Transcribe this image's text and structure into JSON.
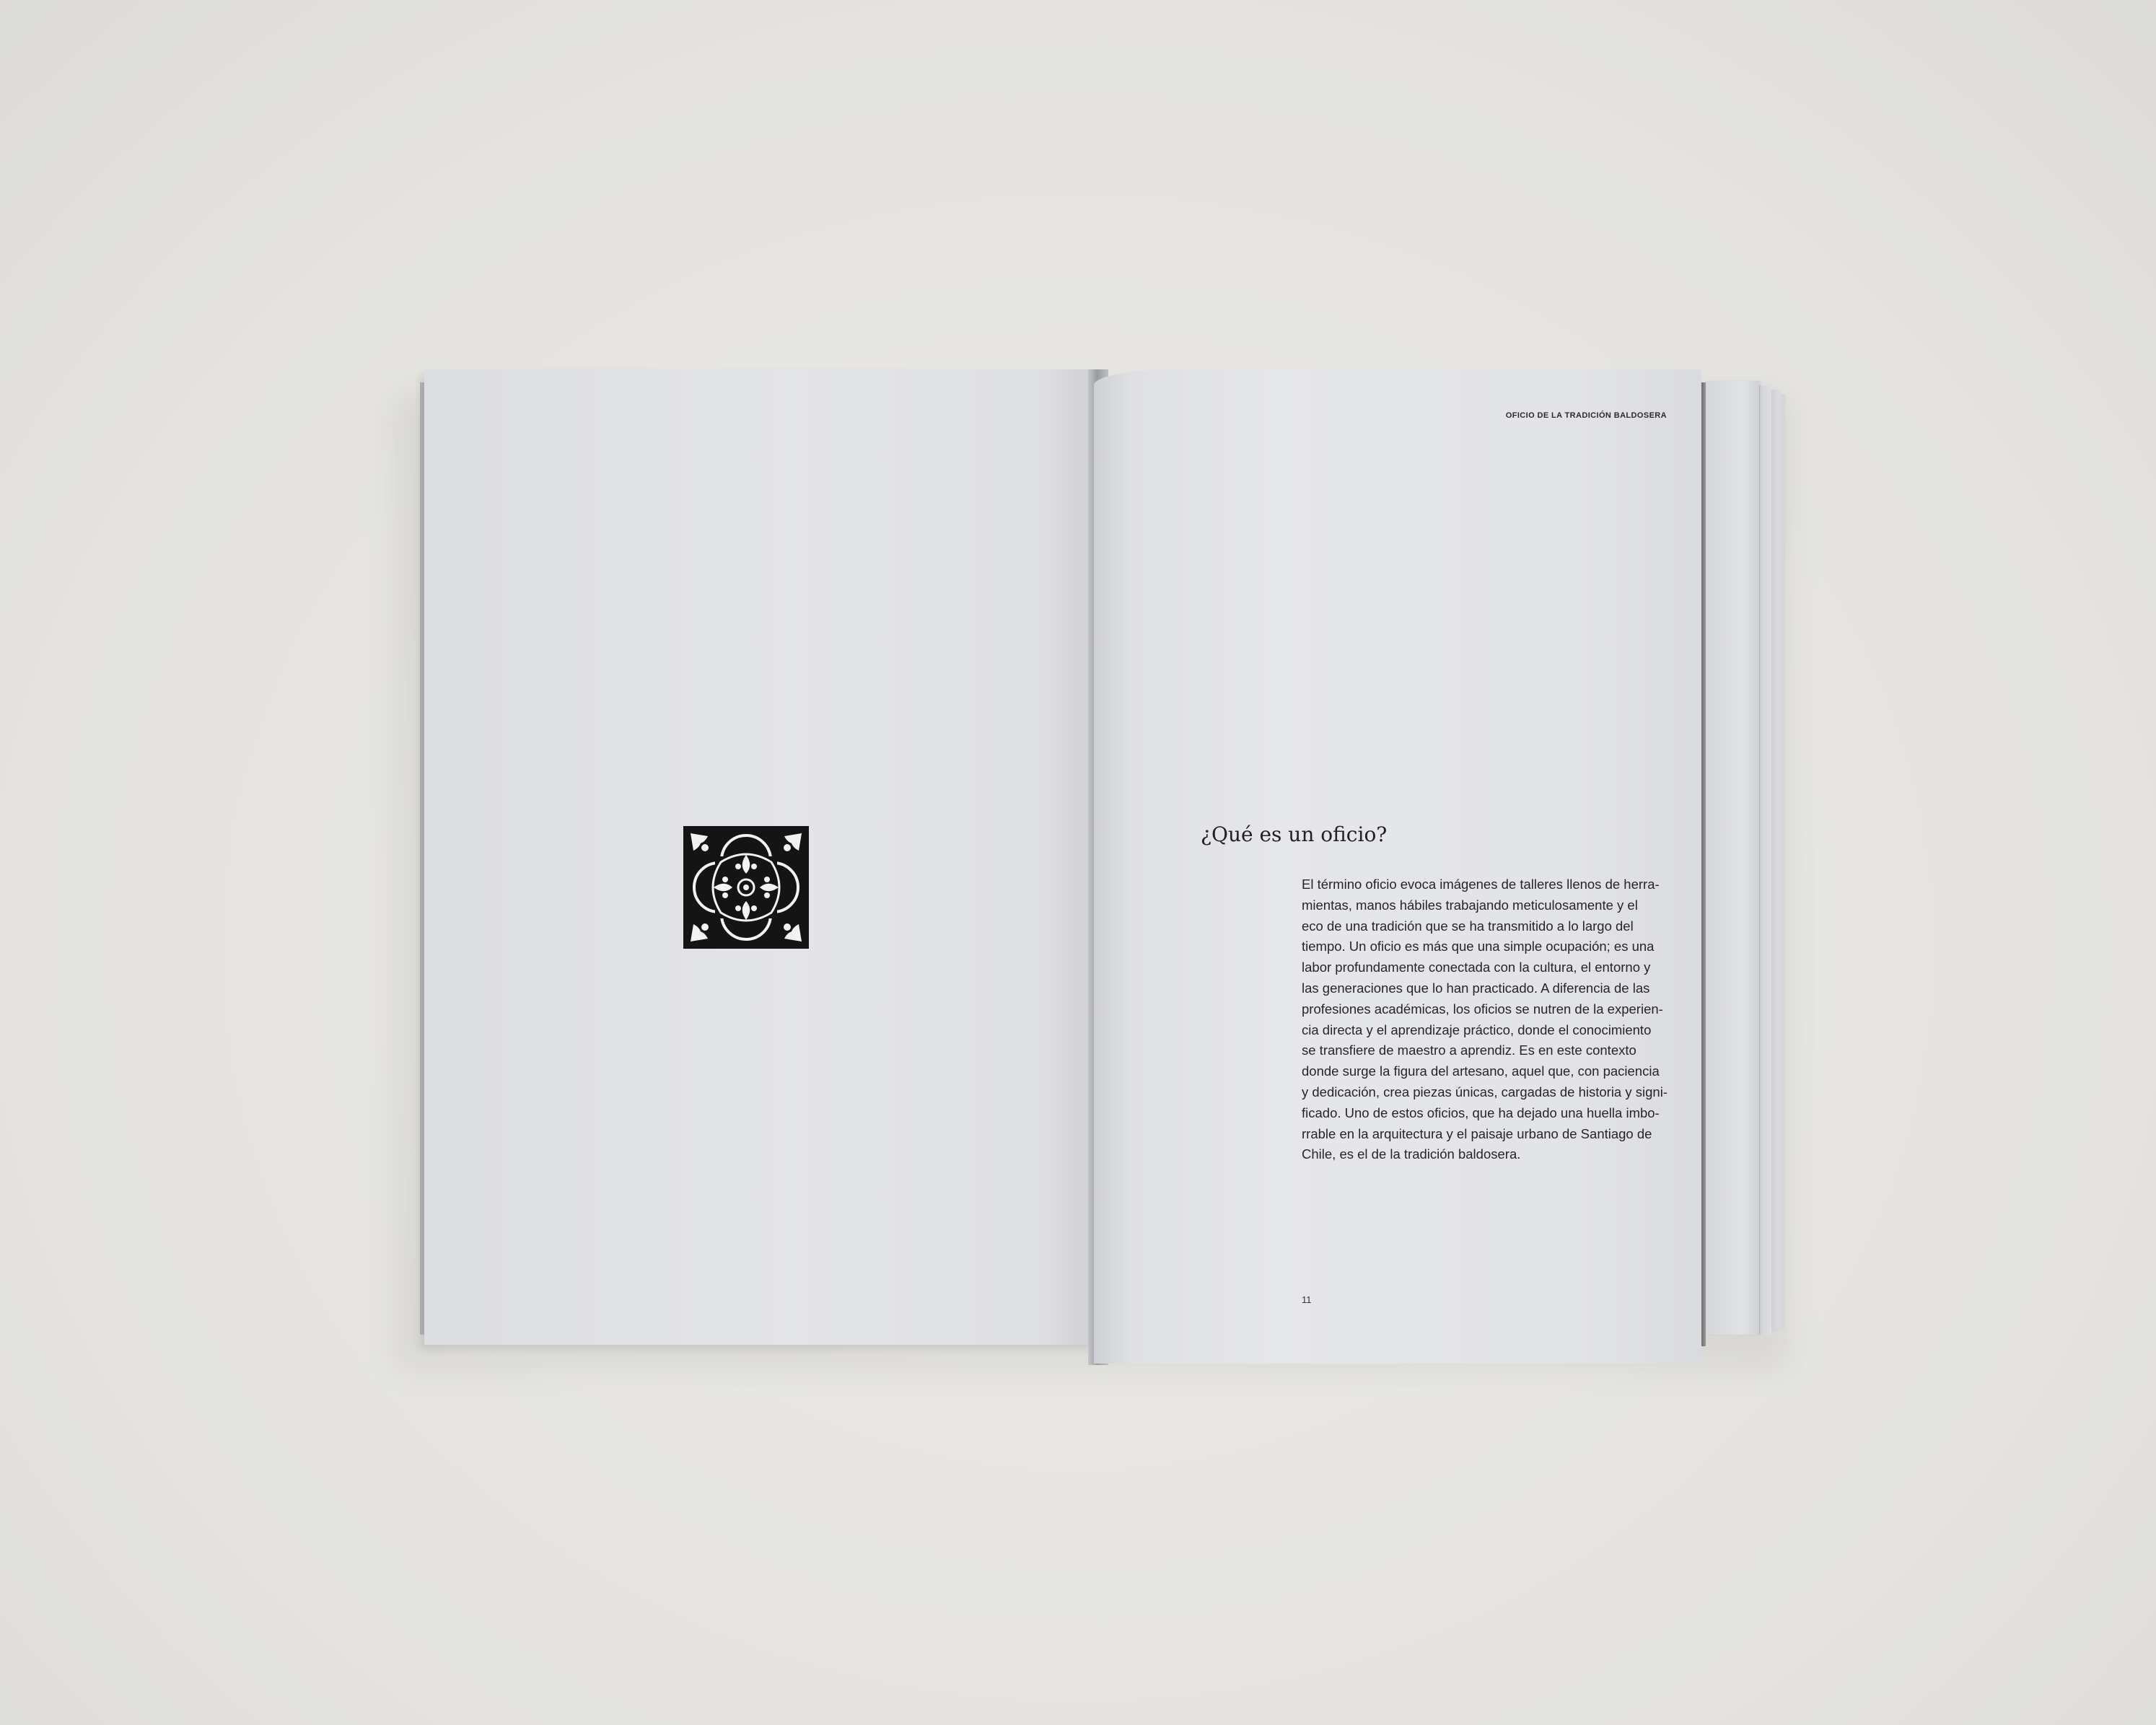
{
  "spread": {
    "right_page": {
      "running_head": "OFICIO DE LA TRADICIÓN BALDOSERA",
      "heading": "¿Qué es un oficio?",
      "body_lines": [
        "El término oficio evoca imágenes de talleres llenos de herra-",
        "mientas, manos hábiles trabajando meticulosamente y el",
        "eco de una tradición que se ha transmitido a lo largo del",
        "tiempo. Un oficio es más que una simple ocupación; es una",
        "labor profundamente conectada con la cultura, el entorno y",
        "las generaciones que lo han practicado. A diferencia de las",
        "profesiones académicas, los oficios se nutren de la experien-",
        "cia directa y el aprendizaje práctico, donde el conocimiento",
        "se transfiere de maestro a aprendiz. Es en este contexto",
        "donde surge la figura del artesano, aquel que, con paciencia",
        "y dedicación, crea piezas únicas, cargadas de historia y signi-",
        "ficado. Uno de estos oficios, que ha dejado una huella imbo-",
        "rrable en la arquitectura y el paisaje urbano de Santiago de",
        "Chile, es el de la tradición baldosera."
      ],
      "page_number": "11"
    },
    "left_page": {
      "ornament_icon": "tile-ornament-icon"
    }
  },
  "colors": {
    "background": "#e6e5e1",
    "paper": "#e4e5e9",
    "ink": "#262626",
    "tile": "#141414"
  }
}
